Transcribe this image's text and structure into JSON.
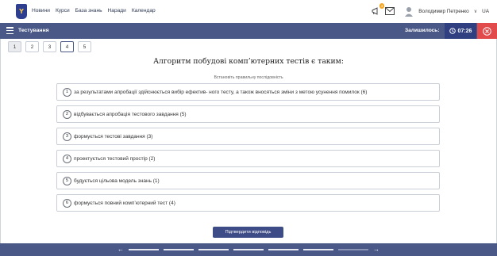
{
  "nav": {
    "logo_text": "Y",
    "links": [
      "Новини",
      "Курси",
      "База знань",
      "Наради",
      "Календар"
    ],
    "notifications_count": "4",
    "user_name": "Володимир Петренко",
    "language": "UA"
  },
  "testbar": {
    "title": "Тестування",
    "remaining_label": "Залишилось:",
    "timer": "07:26"
  },
  "question_tabs": [
    "1",
    "2",
    "3",
    "4",
    "5"
  ],
  "question": {
    "text": "Алгоритм побудові комп’ютерних тестів є таким:",
    "hint": "Встановіть правильну послідовність",
    "answers": [
      {
        "num": "1",
        "text": "за результатами апробації здійснюється вибір ефектив- ного тесту, а також вносяться зміни з метою усунення помилок (6)"
      },
      {
        "num": "2",
        "text": "відбувається апробація тестового завдання (5)"
      },
      {
        "num": "3",
        "text": "формується тестові завдання (3)"
      },
      {
        "num": "4",
        "text": "проектується тестовий простір (2)"
      },
      {
        "num": "5",
        "text": "будується цільова модель знань (1)"
      },
      {
        "num": "6",
        "text": "формується повний комп’ютерний тест (4)"
      }
    ]
  },
  "confirm_label": "Підтвердити відповідь",
  "footer": {
    "prev_icon": "arrow-left-icon",
    "next_icon": "arrow-right-icon"
  },
  "colors": {
    "bar": "#4a5887",
    "timer_bg": "#2f3f80",
    "close": "#e14b4b",
    "button": "#3d4b86"
  }
}
